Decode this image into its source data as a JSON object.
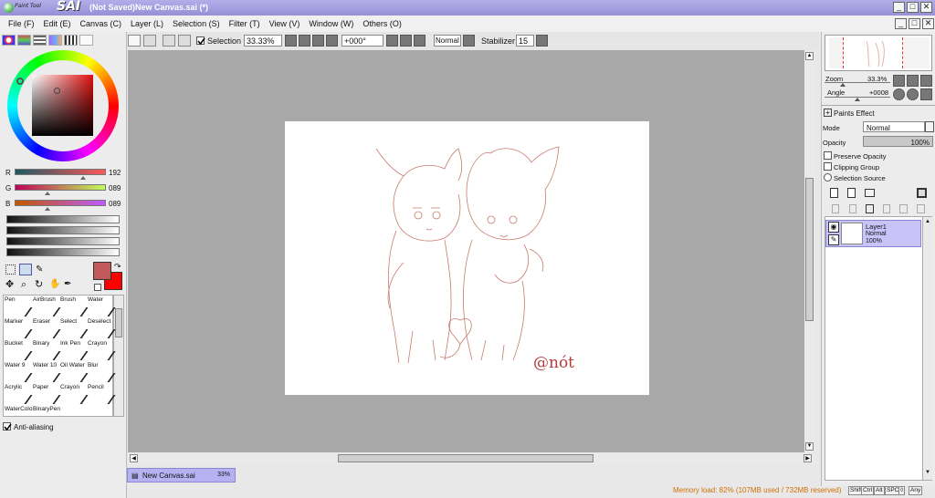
{
  "window": {
    "app_name_small": "Paint Tool",
    "app_name_big": "SAI",
    "title": "(Not Saved)New Canvas.sai (*)",
    "controls": [
      "_",
      "□",
      "✕"
    ],
    "doc_controls": [
      "_",
      "□",
      "✕"
    ]
  },
  "menu": {
    "items": [
      "File (F)",
      "Edit (E)",
      "Canvas (C)",
      "Layer (L)",
      "Selection (S)",
      "Filter (T)",
      "View (V)",
      "Window (W)",
      "Others (O)"
    ]
  },
  "toolbar": {
    "selection_label": "Selection",
    "selection_checked": true,
    "zoom_value": "33.33%",
    "angle_value": "+000°",
    "blend_mode": "Normal",
    "stabilizer_label": "Stabilizer",
    "stabilizer_value": "15"
  },
  "color": {
    "r_label": "R",
    "r_value": "192",
    "g_label": "G",
    "g_value": "089",
    "b_label": "B",
    "b_value": "089",
    "foreground": "#c05959",
    "background": "#ff0000"
  },
  "tools": [
    {
      "label": "Pen"
    },
    {
      "label": "AirBrush"
    },
    {
      "label": "Brush"
    },
    {
      "label": "Water"
    },
    {
      "label": "Marker"
    },
    {
      "label": "Eraser"
    },
    {
      "label": "Select"
    },
    {
      "label": "Deselect"
    },
    {
      "label": "Bucket"
    },
    {
      "label": "Binary"
    },
    {
      "label": "Ink Pen"
    },
    {
      "label": "Crayon"
    },
    {
      "label": "Water 9"
    },
    {
      "label": "Water 10"
    },
    {
      "label": "Oil Water"
    },
    {
      "label": "Blur"
    },
    {
      "label": "Acrylic"
    },
    {
      "label": "Paper"
    },
    {
      "label": "Crayon"
    },
    {
      "label": "Pencil"
    },
    {
      "label": "WaterColor"
    },
    {
      "label": "BinaryPen"
    }
  ],
  "antialiasing": {
    "label": "Anti-aliasing",
    "checked": true
  },
  "canvas": {
    "signature": "@nót"
  },
  "doc_tab": {
    "name": "New Canvas.sai",
    "zoom": "33%"
  },
  "status": {
    "memory": "Memory load: 82% (107MB used / 732MB reserved)",
    "keys": [
      "Shift",
      "Ctrl",
      "Alt",
      "SPC",
      "◊",
      "Any"
    ]
  },
  "navigator": {
    "zoom_label": "Zoom",
    "zoom_value": "33.3%",
    "angle_label": "Angle",
    "angle_value": "+0008"
  },
  "layer_props": {
    "paints_effect": "Paints Effect",
    "mode_label": "Mode",
    "mode_value": "Normal",
    "opacity_label": "Opacity",
    "opacity_value": "100%",
    "preserve_opacity": "Preserve Opacity",
    "clipping_group": "Clipping Group",
    "selection_source": "Selection Source"
  },
  "layers": [
    {
      "name": "Layer1",
      "mode": "Normal",
      "opacity": "100%"
    }
  ]
}
